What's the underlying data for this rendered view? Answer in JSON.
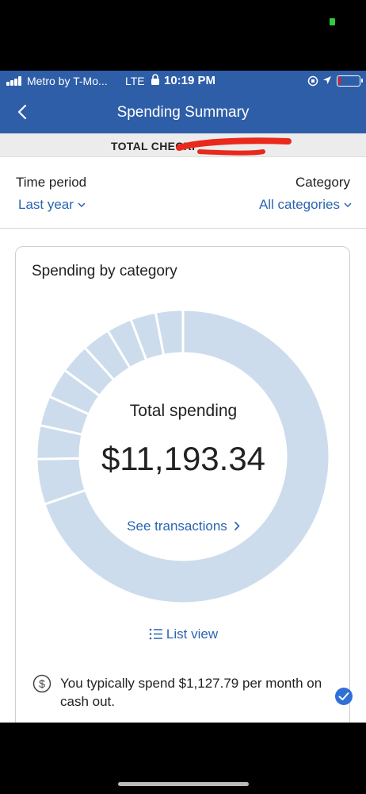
{
  "status_bar": {
    "carrier": "Metro by T-Mo...",
    "network": "LTE",
    "time": "10:19 PM"
  },
  "header": {
    "title": "Spending Summary"
  },
  "account": {
    "name": "TOTAL CHECKI"
  },
  "filters": {
    "time_period_label": "Time period",
    "time_period_value": "Last year",
    "category_label": "Category",
    "category_value": "All categories"
  },
  "card": {
    "title": "Spending by category",
    "total_label": "Total spending",
    "total_amount": "$11,193.34",
    "see_transactions": "See transactions",
    "list_view": "List view",
    "tip_text": "You typically spend $1,127.79 per month on cash out."
  },
  "chart_data": {
    "type": "pie",
    "values": [
      69.8,
      5.0,
      3.7,
      3.3,
      3.3,
      3.3,
      3.1,
      2.8,
      2.8,
      3.0
    ],
    "segment_color": "#ccdcec",
    "separator_color": "#ffffff"
  }
}
